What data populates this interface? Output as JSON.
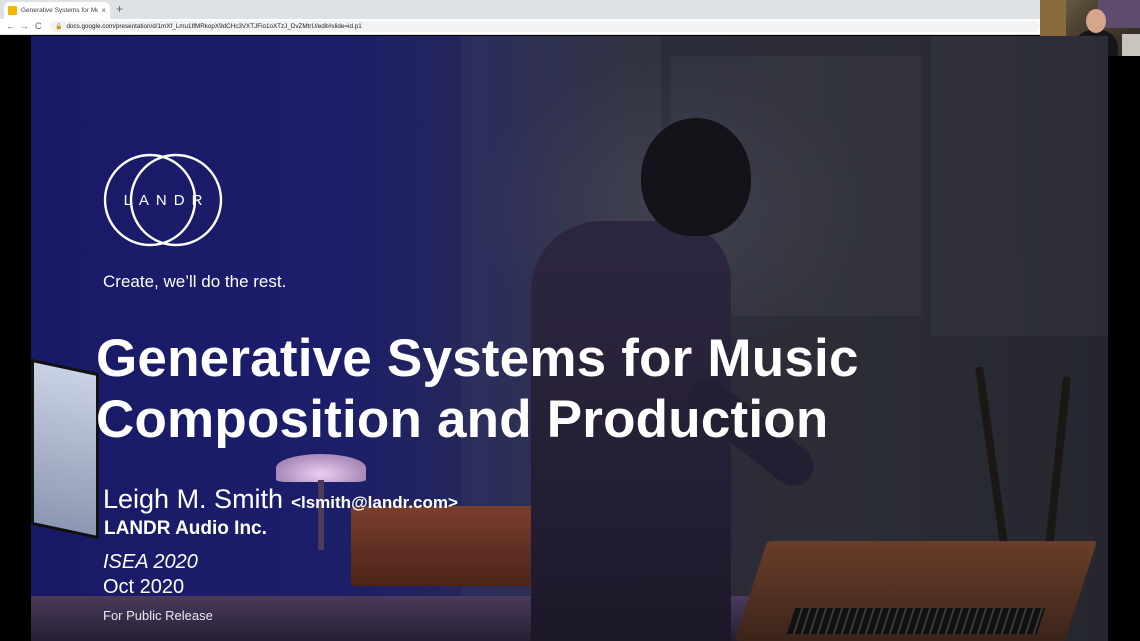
{
  "browser": {
    "tab_title": "Generative Systems for Music",
    "tab_close": "×",
    "new_tab": "+",
    "back": "←",
    "forward": "→",
    "reload": "C",
    "url": "docs.google.com/presentation/d/1mXf_Lmu1IfMRkopX9dCHc3VXTJFio1oXTzJ_DvZMtrU/edit#slide=id.p1"
  },
  "slide": {
    "logo_text": "LANDR",
    "tagline": "Create, we’ll do the rest.",
    "title_line1": "Generative Systems for Music",
    "title_line2": "Composition and Production",
    "author_name": "Leigh M. Smith",
    "author_email": "<lsmith@landr.com>",
    "company": "LANDR Audio Inc.",
    "conference": "ISEA 2020",
    "date": "Oct 2020",
    "release_note": "For Public Release"
  },
  "colors": {
    "slide_left": "#1b1d6a",
    "slide_right": "#2a2b34",
    "text": "#ffffff",
    "tab_strip": "#dee1e6",
    "slides_favicon": "#f4b400"
  },
  "icons": {
    "favicon": "google-slides-icon",
    "lock": "lock-icon",
    "close": "close-icon",
    "new_tab": "plus-icon"
  }
}
